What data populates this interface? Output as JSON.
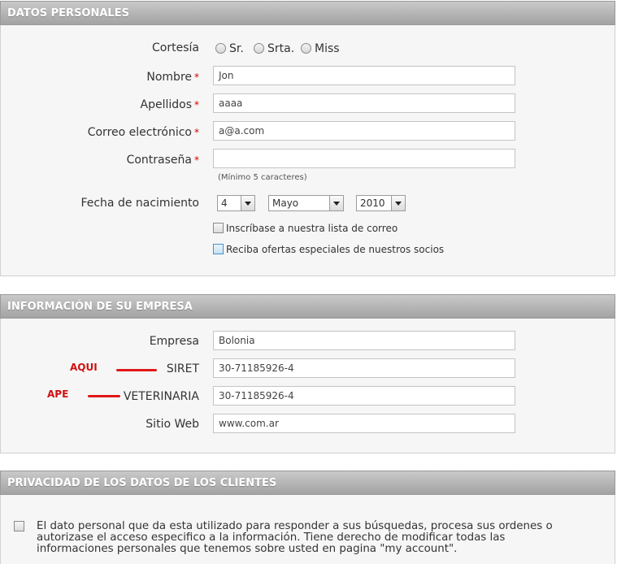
{
  "personal": {
    "header": "DATOS PERSONALES",
    "courtesy_label": "Cortesía",
    "courtesy_options": [
      "Sr.",
      "Srta.",
      "Miss"
    ],
    "required_mark": "*",
    "nombre_label": "Nombre",
    "nombre_value": "Jon",
    "apellidos_label": "Apellidos",
    "apellidos_value": "aaaa",
    "email_label": "Correo electrónico",
    "email_value": "a@a.com",
    "password_label": "Contraseña",
    "password_value": "",
    "password_hint": "(Mínimo 5 caracteres)",
    "birth_label": "Fecha de nacimiento",
    "birth_day": "4",
    "birth_month": "Mayo",
    "birth_year": "2010",
    "newsletter_label": "Inscríbase a nuestra lista de correo",
    "offers_label": "Reciba ofertas especiales de nuestros socios"
  },
  "company": {
    "header": "INFORMACIÓN DE SU EMPRESA",
    "empresa_label": "Empresa",
    "empresa_value": "Bolonia",
    "siret_label": "SIRET",
    "siret_value": "30-71185926-4",
    "vet_label": "VETERINARIA",
    "vet_value": "30-71185926-4",
    "web_label": "Sitio Web",
    "web_value": "www.com.ar",
    "annot_aqui": "AQUI",
    "annot_ape": "APE"
  },
  "privacy": {
    "header": "PRIVACIDAD DE LOS DATOS DE LOS CLIENTES",
    "text": "El dato personal que da esta utilizado para responder a sus búsquedas, procesa sus ordenes o autorizase el acceso especifico a la información. Tiene derecho de modificar todas las informaciones personales que tenemos sobre usted en pagina \"my account\"."
  },
  "colors": {
    "header_bg": "#b0b0b0",
    "body_bg": "#f6f6f6",
    "required": "#cc0000",
    "annotation": "#d01010"
  }
}
